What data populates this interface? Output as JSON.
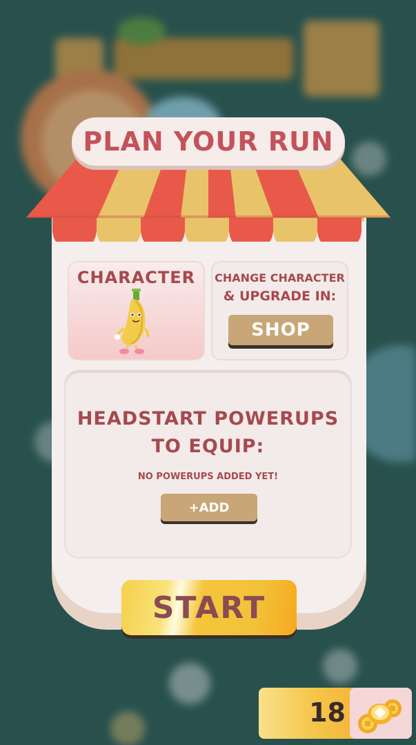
{
  "title": "PLAN YOUR RUN",
  "character": {
    "label": "CHARACTER",
    "image": "banana-character"
  },
  "shop": {
    "text_line1": "CHANGE CHARACTER",
    "text_line2": "& UPGRADE IN:",
    "button_label": "SHOP"
  },
  "powerups": {
    "title_line1": "HEADSTART POWERUPS",
    "title_line2": "TO EQUIP:",
    "empty_text": "NO POWERUPS ADDED YET!",
    "add_label": "+ADD"
  },
  "start_label": "START",
  "currency": {
    "count": "18",
    "icon": "coins-icon"
  },
  "colors": {
    "accent_text": "#a6494e",
    "title_text": "#c4525a",
    "awning_red": "#e8594a",
    "awning_yellow": "#e9c36a",
    "button_tan": "#c9a677",
    "start_yellow": "#f5c53a"
  }
}
